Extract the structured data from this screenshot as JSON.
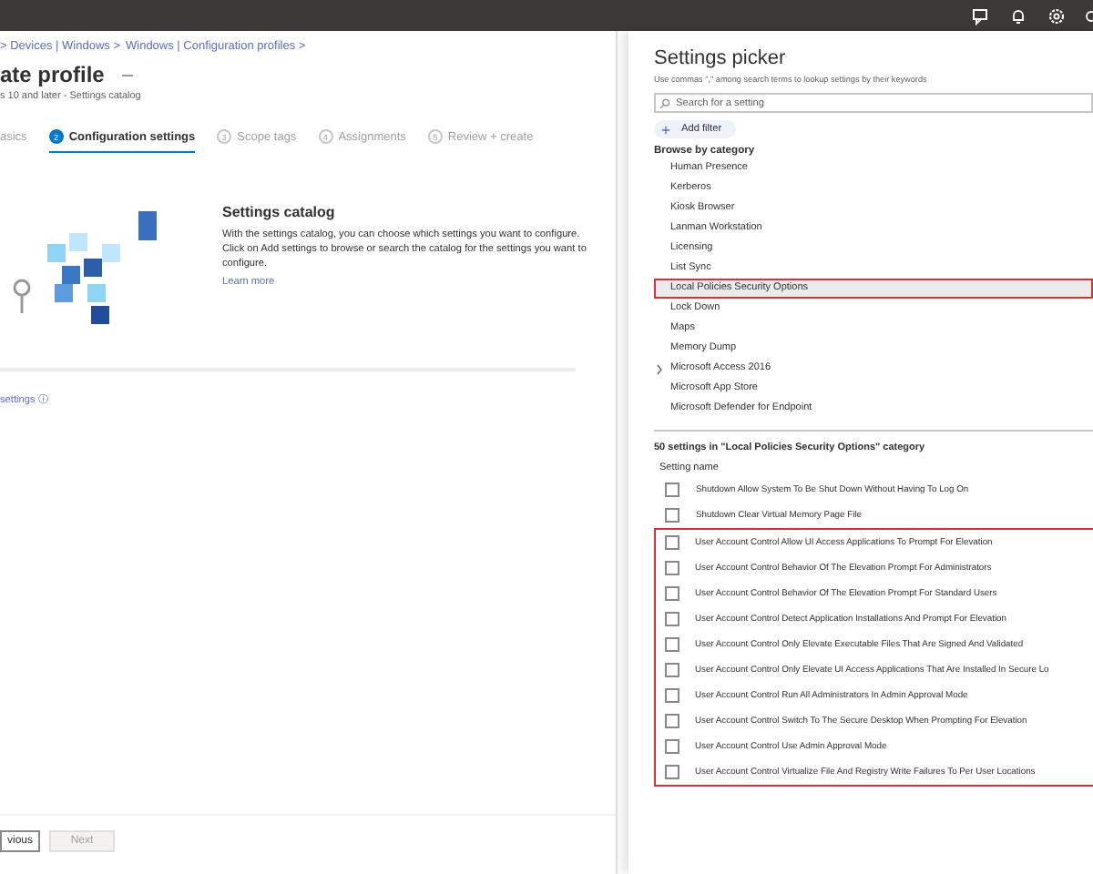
{
  "topbar": {
    "icons": [
      {
        "kind": "feedback"
      },
      {
        "kind": "notifications"
      },
      {
        "kind": "settings"
      },
      {
        "kind": "more"
      }
    ]
  },
  "left": {
    "breadcrumb": [
      "> Devices | Windows >",
      "Windows | Configuration profiles >"
    ],
    "title": "ate profile",
    "subtitle": "s 10 and later - Settings catalog",
    "steps": [
      {
        "label": "asics",
        "selected": false
      },
      {
        "number": "2",
        "label": "Configuration settings",
        "selected": true
      },
      {
        "number": "3",
        "label": "Scope tags",
        "selected": false
      },
      {
        "number": "4",
        "label": "Assignments",
        "selected": false
      },
      {
        "number": "5",
        "label": "Review + create",
        "selected": false
      }
    ],
    "catalog": {
      "heading": "Settings catalog",
      "body": "With the settings catalog, you can choose which settings you want to configure. Click on Add settings to browse or search the catalog for the settings you want to configure.",
      "link": "Learn more"
    },
    "add_link": "settings ⓘ",
    "buttons": [
      {
        "label": "vious",
        "disabled": false
      },
      {
        "label": "Next",
        "disabled": true
      }
    ]
  },
  "picker": {
    "title": "Settings picker",
    "hint": "Use commas \",\" among search terms to lookup settings by their keywords",
    "search": {
      "placeholder": "Search for a setting"
    },
    "add_filter": "Add filter",
    "browse_label": "Browse by category",
    "categories": [
      {
        "label": "Human Presence",
        "selected": false,
        "expandable": false
      },
      {
        "label": "Kerberos",
        "selected": false,
        "expandable": false
      },
      {
        "label": "Kiosk Browser",
        "selected": false,
        "expandable": false
      },
      {
        "label": "Lanman Workstation",
        "selected": false,
        "expandable": false
      },
      {
        "label": "Licensing",
        "selected": false,
        "expandable": false
      },
      {
        "label": "List Sync",
        "selected": false,
        "expandable": false
      },
      {
        "label": "Local Policies Security Options",
        "selected": true,
        "expandable": false
      },
      {
        "label": "Lock Down",
        "selected": false,
        "expandable": false
      },
      {
        "label": "Maps",
        "selected": false,
        "expandable": false
      },
      {
        "label": "Memory Dump",
        "selected": false,
        "expandable": false
      },
      {
        "label": "Microsoft Access 2016",
        "selected": false,
        "expandable": true
      },
      {
        "label": "Microsoft App Store",
        "selected": false,
        "expandable": false
      },
      {
        "label": "Microsoft Defender for Endpoint",
        "selected": false,
        "expandable": false
      }
    ],
    "count": "50 settings in \"Local Policies Security Options\" category",
    "column": "Setting name",
    "rows": [
      {
        "label": "Shutdown Allow System To Be Shut Down Without Having To Log On",
        "checked": false,
        "highlighted": false
      },
      {
        "label": "Shutdown Clear Virtual Memory Page File",
        "checked": false,
        "highlighted": false
      },
      {
        "label": "User Account Control Allow UI Access Applications To Prompt For Elevation",
        "checked": false,
        "highlighted": true
      },
      {
        "label": "User Account Control Behavior Of The Elevation Prompt For Administrators",
        "checked": false,
        "highlighted": true
      },
      {
        "label": "User Account Control Behavior Of The Elevation Prompt For Standard Users",
        "checked": false,
        "highlighted": true
      },
      {
        "label": "User Account Control Detect Application Installations And Prompt For Elevation",
        "checked": false,
        "highlighted": true
      },
      {
        "label": "User Account Control Only Elevate Executable Files That Are Signed And Validated",
        "checked": false,
        "highlighted": true
      },
      {
        "label": "User Account Control Only Elevate UI Access Applications That Are Installed In Secure Lo",
        "checked": false,
        "highlighted": true
      },
      {
        "label": "User Account Control Run All Administrators In Admin Approval Mode",
        "checked": false,
        "highlighted": true
      },
      {
        "label": "User Account Control Switch To The Secure Desktop When Prompting For Elevation",
        "checked": false,
        "highlighted": true
      },
      {
        "label": "User Account Control Use Admin Approval Mode",
        "checked": false,
        "highlighted": true
      },
      {
        "label": "User Account Control Virtualize File And Registry Write Failures To Per User Locations",
        "checked": false,
        "highlighted": true
      }
    ]
  }
}
